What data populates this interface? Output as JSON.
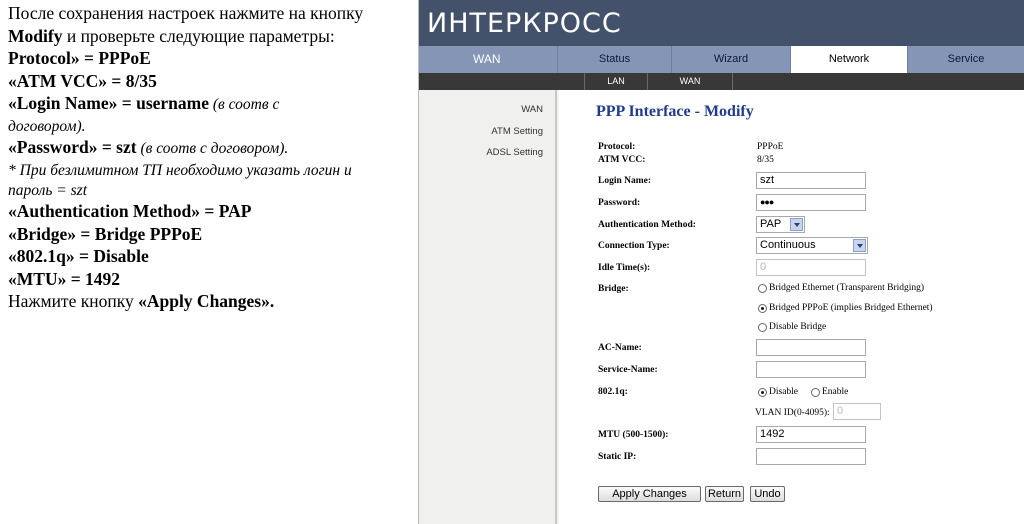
{
  "doc": {
    "l1": "После сохранения настроек нажмите на кнопку",
    "l2_b": "Modify",
    "l2": " и проверьте следующие параметры:",
    "l3_b": "Protocol»  = PPPoE",
    "l4_b": "«ATM VCC» =  8/35",
    "l5_b": "«Login Name» = username",
    "l5_i": " (в соотв с",
    "l6_i": "договором).",
    "l7_b": "«Password» = szt",
    "l7_i": " (в соотв с договором).",
    "l8": "* При безлимитном ТП необходимо указать логин и",
    "l9": "пароль = szt",
    "l10_b": "«Authentication Method» = PAP",
    "l11_b": "«Bridge» = Bridge PPPoE",
    "l12_b": "«802.1q» = Disable",
    "l13_b": "«MTU» = 1492",
    "l14": "Нажмите кнопку ",
    "l14_b": "«Apply Changes»."
  },
  "ui": {
    "logo_text": "ИНТЕРКРОСС",
    "nav": {
      "section": "WAN",
      "tabs": [
        "Status",
        "Wizard",
        "Network",
        "Service"
      ],
      "active_tab": "Network"
    },
    "subnav": [
      "LAN",
      "WAN"
    ],
    "sidebar": [
      "WAN",
      "ATM Setting",
      "ADSL Setting"
    ],
    "title": "PPP Interface - Modify",
    "form": {
      "protocol_label": "Protocol:",
      "protocol_value": "PPPoE",
      "atm_label": "ATM VCC:",
      "atm_value": "8/35",
      "login_label": "Login Name:",
      "login_value": "szt",
      "password_label": "Password:",
      "password_value": "●●●",
      "auth_label": "Authentication Method:",
      "auth_value": "PAP",
      "conn_label": "Connection Type:",
      "conn_value": "Continuous",
      "idle_label": "Idle Time(s):",
      "idle_value": "0",
      "bridge_label": "Bridge:",
      "bridge_opt1": "Bridged Ethernet (Transparent Bridging)",
      "bridge_opt2": "Bridged PPPoE (implies Bridged Ethernet)",
      "bridge_opt3": "Disable Bridge",
      "ac_label": "AC-Name:",
      "ac_value": "",
      "service_label": "Service-Name:",
      "service_value": "",
      "q_label": "802.1q:",
      "q_disable": "Disable",
      "q_enable": "Enable",
      "vlan_label": "VLAN ID(0-4095):",
      "vlan_value": "0",
      "mtu_label": "MTU (500-1500):",
      "mtu_value": "1492",
      "static_label": "Static IP:",
      "static_value": ""
    },
    "buttons": {
      "apply": "Apply Changes",
      "return": "Return",
      "undo": "Undo"
    },
    "colors": {
      "logo_bar": "#43526a",
      "nav_bar": "#8595b5",
      "sub_bar": "#383838",
      "title": "#1f3b8c"
    }
  }
}
